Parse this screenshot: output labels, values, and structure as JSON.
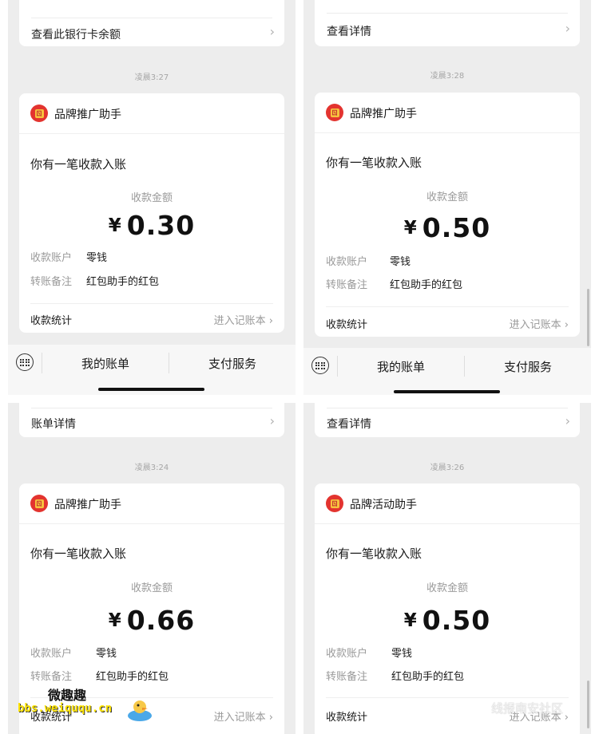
{
  "panels": [
    {
      "top_link": "查看此银行卡余额",
      "time": "凌晨3:27",
      "brand": "品牌推广助手",
      "notice": "你有一笔收款入账",
      "amount_label": "收款金额",
      "currency": "¥",
      "amount": "0.30",
      "account_key": "收款账户",
      "account_val": "零钱",
      "memo_key": "转账备注",
      "memo_val": "红包助手的红包",
      "stat": "收款统计",
      "go": "进入记账本",
      "tab1": "我的账单",
      "tab2": "支付服务"
    },
    {
      "top_link": "查看详情",
      "time": "凌晨3:28",
      "brand": "品牌推广助手",
      "notice": "你有一笔收款入账",
      "amount_label": "收款金额",
      "currency": "¥",
      "amount": "0.50",
      "account_key": "收款账户",
      "account_val": "零钱",
      "memo_key": "转账备注",
      "memo_val": "红包助手的红包",
      "stat": "收款统计",
      "go": "进入记账本",
      "tab1": "我的账单",
      "tab2": "支付服务"
    },
    {
      "top_link": "账单详情",
      "time": "凌晨3:24",
      "brand": "品牌推广助手",
      "notice": "你有一笔收款入账",
      "amount_label": "收款金额",
      "currency": "¥",
      "amount": "0.66",
      "account_key": "收款账户",
      "account_val": "零钱",
      "memo_key": "转账备注",
      "memo_val": "红包助手的红包",
      "stat": "收款统计",
      "go": "进入记账本"
    },
    {
      "top_link": "查看详情",
      "time": "凌晨3:26",
      "brand": "品牌活动助手",
      "notice": "你有一笔收款入账",
      "amount_label": "收款金额",
      "currency": "¥",
      "amount": "0.50",
      "account_key": "收款账户",
      "account_val": "零钱",
      "memo_key": "转账备注",
      "memo_val": "红包助手的红包",
      "stat": "收款统计",
      "go": "进入记账本"
    }
  ],
  "chevron": "›",
  "watermark": {
    "name": "微趣趣",
    "url": "bbs.weiququ.cn",
    "community": "线报南安社区"
  }
}
